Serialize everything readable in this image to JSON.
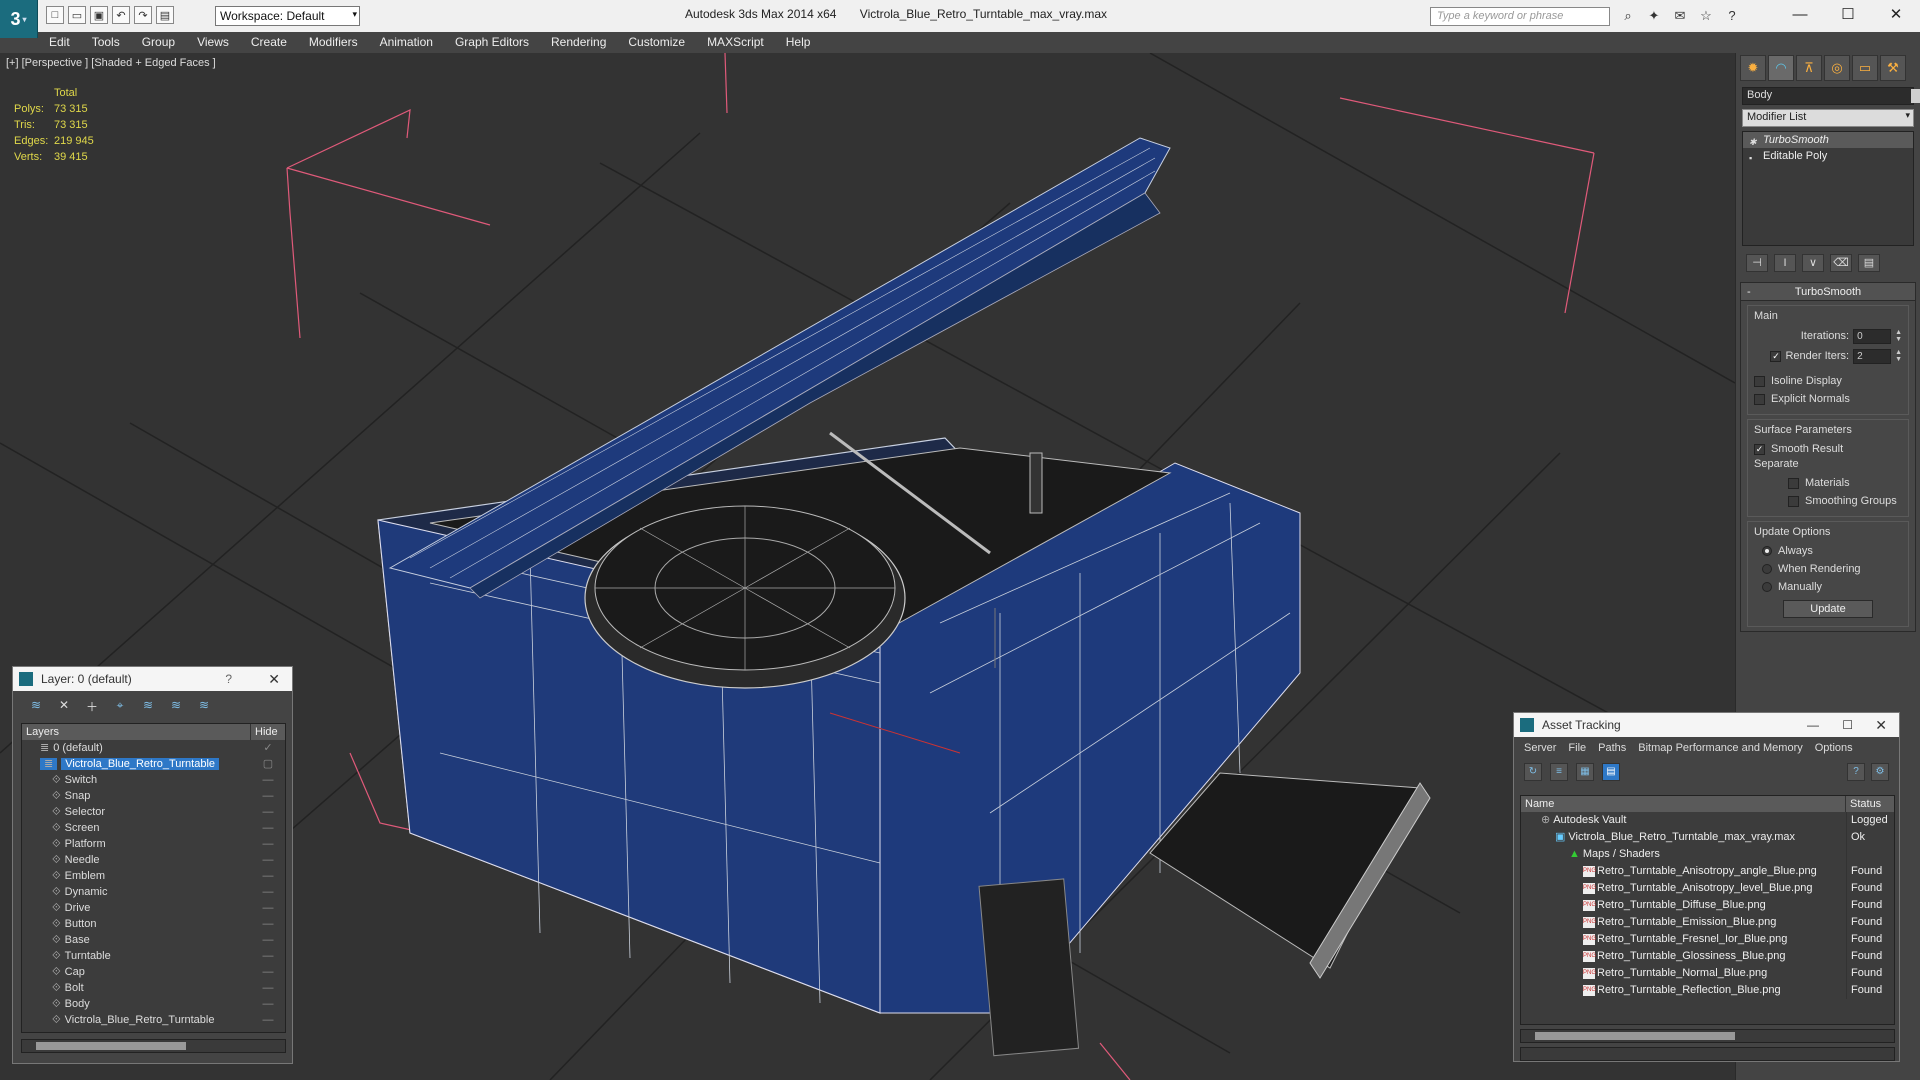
{
  "titlebar": {
    "workspace": "Workspace: Default",
    "app_name": "Autodesk 3ds Max  2014 x64",
    "file_name": "Victrola_Blue_Retro_Turntable_max_vray.max",
    "search_placeholder": "Type a keyword or phrase"
  },
  "menu": [
    "Edit",
    "Tools",
    "Group",
    "Views",
    "Create",
    "Modifiers",
    "Animation",
    "Graph Editors",
    "Rendering",
    "Customize",
    "MAXScript",
    "Help"
  ],
  "viewport": {
    "label": "[+] [Perspective ] [Shaded + Edged Faces ]",
    "stats_header": "Total",
    "stats": [
      {
        "k": "Polys:",
        "v": "73 315"
      },
      {
        "k": "Tris:",
        "v": "73 315"
      },
      {
        "k": "Edges:",
        "v": "219 945"
      },
      {
        "k": "Verts:",
        "v": "39 415"
      }
    ]
  },
  "command_panel": {
    "object_name": "Body",
    "modifier_list": "Modifier List",
    "stack": [
      "TurboSmooth",
      "Editable Poly"
    ],
    "rollout_title": "TurboSmooth",
    "main_label": "Main",
    "iterations_label": "Iterations:",
    "iterations_value": "0",
    "render_iters_label": "Render Iters:",
    "render_iters_value": "2",
    "isoline": "Isoline Display",
    "explicit_normals": "Explicit Normals",
    "surface_params": "Surface Parameters",
    "smooth_result": "Smooth Result",
    "separate": "Separate",
    "materials": "Materials",
    "smoothing_groups": "Smoothing Groups",
    "update_options": "Update Options",
    "always": "Always",
    "when_rendering": "When Rendering",
    "manually": "Manually",
    "update_btn": "Update"
  },
  "layer_dialog": {
    "title": "Layer: 0 (default)",
    "col_layers": "Layers",
    "col_hide": "Hide",
    "rows": [
      {
        "name": "0 (default)",
        "indent": 1
      },
      {
        "name": "Victrola_Blue_Retro_Turntable",
        "indent": 1,
        "selected": true
      },
      {
        "name": "Switch",
        "indent": 2
      },
      {
        "name": "Snap",
        "indent": 2
      },
      {
        "name": "Selector",
        "indent": 2
      },
      {
        "name": "Screen",
        "indent": 2
      },
      {
        "name": "Platform",
        "indent": 2
      },
      {
        "name": "Needle",
        "indent": 2
      },
      {
        "name": "Emblem",
        "indent": 2
      },
      {
        "name": "Dynamic",
        "indent": 2
      },
      {
        "name": "Drive",
        "indent": 2
      },
      {
        "name": "Button",
        "indent": 2
      },
      {
        "name": "Base",
        "indent": 2
      },
      {
        "name": "Turntable",
        "indent": 2
      },
      {
        "name": "Cap",
        "indent": 2
      },
      {
        "name": "Bolt",
        "indent": 2
      },
      {
        "name": "Body",
        "indent": 2
      },
      {
        "name": "Victrola_Blue_Retro_Turntable",
        "indent": 2
      }
    ]
  },
  "asset_tracking": {
    "title": "Asset Tracking",
    "menu": [
      "Server",
      "File",
      "Paths",
      "Bitmap Performance and Memory",
      "Options"
    ],
    "col_name": "Name",
    "col_status": "Status",
    "rows": [
      {
        "name": "Autodesk Vault",
        "status": "Logged",
        "indent": 1
      },
      {
        "name": "Victrola_Blue_Retro_Turntable_max_vray.max",
        "status": "Ok",
        "indent": 2
      },
      {
        "name": "Maps / Shaders",
        "status": "",
        "indent": 3
      },
      {
        "name": "Retro_Turntable_Anisotropy_angle_Blue.png",
        "status": "Found",
        "indent": 4
      },
      {
        "name": "Retro_Turntable_Anisotropy_level_Blue.png",
        "status": "Found",
        "indent": 4
      },
      {
        "name": "Retro_Turntable_Diffuse_Blue.png",
        "status": "Found",
        "indent": 4
      },
      {
        "name": "Retro_Turntable_Emission_Blue.png",
        "status": "Found",
        "indent": 4
      },
      {
        "name": "Retro_Turntable_Fresnel_Ior_Blue.png",
        "status": "Found",
        "indent": 4
      },
      {
        "name": "Retro_Turntable_Glossiness_Blue.png",
        "status": "Found",
        "indent": 4
      },
      {
        "name": "Retro_Turntable_Normal_Blue.png",
        "status": "Found",
        "indent": 4
      },
      {
        "name": "Retro_Turntable_Reflection_Blue.png",
        "status": "Found",
        "indent": 4
      }
    ]
  },
  "colors": {
    "viewport_bg": "#333333",
    "stats": "#e0d84a",
    "model_blue": "#1e3a78",
    "selection": "#2e78c7"
  }
}
